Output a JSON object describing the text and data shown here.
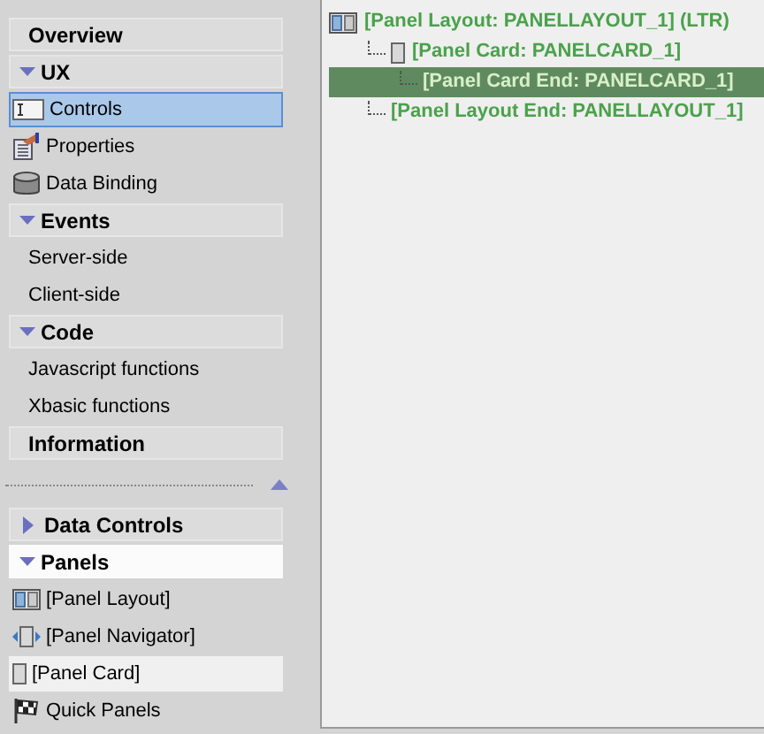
{
  "sidebar": {
    "upper": [
      {
        "kind": "header",
        "label": "Overview"
      },
      {
        "kind": "group",
        "label": "UX",
        "expanded": true
      },
      {
        "kind": "item",
        "label": "Controls",
        "selected": true
      },
      {
        "kind": "item",
        "label": "Properties",
        "selected": false
      },
      {
        "kind": "item",
        "label": "Data Binding",
        "selected": false
      },
      {
        "kind": "group",
        "label": "Events",
        "expanded": true
      },
      {
        "kind": "item",
        "label": "Server-side",
        "selected": false
      },
      {
        "kind": "item",
        "label": "Client-side",
        "selected": false
      },
      {
        "kind": "group",
        "label": "Code",
        "expanded": true
      },
      {
        "kind": "item",
        "label": "Javascript functions",
        "selected": false
      },
      {
        "kind": "item",
        "label": "Xbasic functions",
        "selected": false
      },
      {
        "kind": "header",
        "label": "Information"
      }
    ],
    "lower": [
      {
        "kind": "group",
        "label": "Data Controls",
        "expanded": false
      },
      {
        "kind": "group",
        "label": "Panels",
        "expanded": true
      },
      {
        "kind": "item",
        "label": "[Panel Layout]",
        "selected": false
      },
      {
        "kind": "item",
        "label": "[Panel Navigator]",
        "selected": false
      },
      {
        "kind": "item",
        "label": "[Panel Card]",
        "selected": true
      },
      {
        "kind": "item",
        "label": "Quick Panels",
        "selected": false
      }
    ]
  },
  "tree": [
    {
      "label": "[Panel Layout: PANELLAYOUT_1] (LTR)",
      "selected": false,
      "children": [
        {
          "label": "[Panel Card: PANELCARD_1]",
          "selected": false,
          "children": [
            {
              "label": "[Panel Card End: PANELCARD_1]",
              "selected": true
            }
          ]
        },
        {
          "label": "[Panel Layout End: PANELLAYOUT_1]",
          "selected": false
        }
      ]
    }
  ]
}
